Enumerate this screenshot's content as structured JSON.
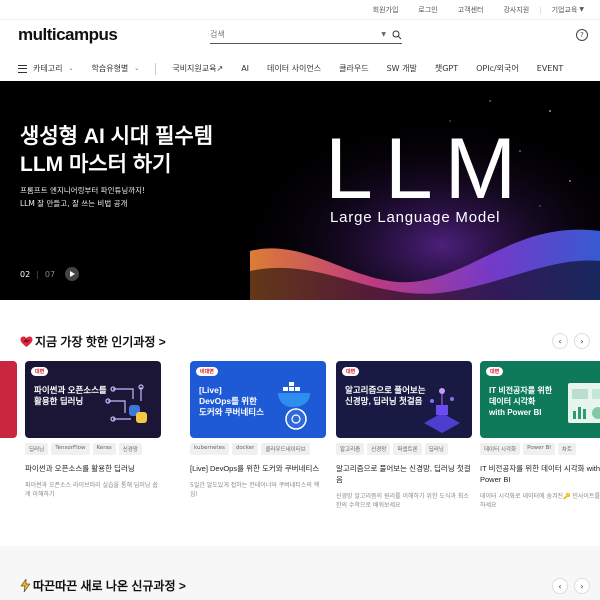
{
  "util": {
    "links": [
      "회원가입",
      "로그인",
      "고객센터",
      "강사지원"
    ],
    "corp": "기업교육"
  },
  "header": {
    "logo": "multicampus",
    "search_placeholder": "검색"
  },
  "nav": {
    "items": [
      {
        "label": "카테고리",
        "chevron": true
      },
      {
        "label": "학습유형별",
        "chevron": true
      },
      {
        "label": "국비지원교육↗"
      },
      {
        "label": "AI"
      },
      {
        "label": "데이터 사이언스"
      },
      {
        "label": "클라우드"
      },
      {
        "label": "SW 개발"
      },
      {
        "label": "챗GPT"
      },
      {
        "label": "OPIc/외국어"
      },
      {
        "label": "EVENT"
      }
    ]
  },
  "hero": {
    "title_line1": "생성형 AI 시대 필수템",
    "title_line2": "LLM 마스터 하기",
    "sub_line1": "프롬프트 엔지니어링부터 파인튜닝까지!",
    "sub_line2": "LLM 잘 만들고, 잘 쓰는 비법 공개",
    "current": "02",
    "total": "07",
    "art_big": "LLM",
    "art_small": "Large Language Model"
  },
  "popular": {
    "title": "지금 가장 핫한 인기과정 >",
    "cards": [
      {
        "badge": "대면",
        "thumb_text": "파이썬과 오픈소스를\n활용한 딥러닝",
        "tags": [
          "딥러닝",
          "TensorFlow",
          "Keras",
          "신경망"
        ],
        "title": "파이썬과 오픈소스를 활용한 딥러닝",
        "desc": "파이썬과 오픈소스 라이브러리 실습을 통해 딥러닝 쉽게 이해하기",
        "color": "#1b1636"
      },
      {
        "badge": "비대면",
        "thumb_text": "[Live]\nDevOps를 위한\n도커와 쿠버네티스",
        "tags": [
          "kubernetes",
          "docker",
          "클라우드네이티브"
        ],
        "title": "[Live] DevOps를 위한 도커와 쿠버네티스",
        "desc": "5일간 알도있게 접하는 컨테이너와 쿠버네티스의 핵심!",
        "color": "#1f5ad6"
      },
      {
        "badge": "대면",
        "thumb_text": "알고리즘으로 풀어보는\n신경망, 딥러닝 첫걸음",
        "tags": [
          "알고리즘",
          "신경망",
          "퍼셉트론",
          "딥러닝"
        ],
        "title": "알고리즘으로 풀어보는 신경망, 딥러닝 첫걸음",
        "desc": "신경망 알고리즘의 원리를 이해하기 위한 도식과 최소한의 수학으로 배워보세요",
        "color": "#191a44"
      },
      {
        "badge": "대면",
        "thumb_text": "IT 비전공자를 위한\n데이터 시각화\nwith Power BI",
        "tags": [
          "데이터 시각화",
          "Power BI",
          "차트"
        ],
        "title": "IT 비전공자를 위한 데이터 시각화 with Power BI",
        "desc": "데이터 시각화로 데이터에 숨겨진🔑 인사이트를 확인하세요",
        "color": "#0f7a5a"
      }
    ]
  },
  "new": {
    "title": "따끈따끈 새로 나온 신규과정 >"
  }
}
